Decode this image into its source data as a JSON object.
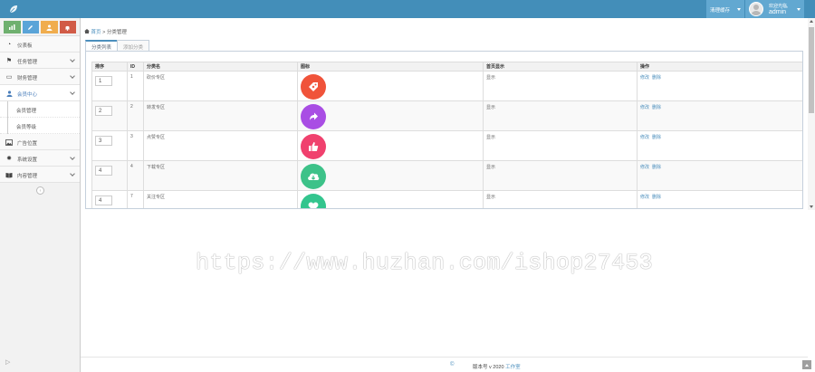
{
  "topbar": {
    "clear_cache_label": "清理缓存",
    "welcome": "欢迎光临,",
    "username": "admin"
  },
  "sidebar": {
    "items": [
      {
        "label": "仪表板",
        "icon": "dashboard-icon"
      },
      {
        "label": "任务管理",
        "icon": "flag-icon"
      },
      {
        "label": "财务管理",
        "icon": "wallet-icon"
      },
      {
        "label": "会员中心",
        "icon": "user-icon",
        "open": true
      },
      {
        "label": "广告位置",
        "icon": "picture-icon"
      },
      {
        "label": "系统设置",
        "icon": "gear-icon"
      },
      {
        "label": "内容管理",
        "icon": "book-icon"
      }
    ],
    "subitems": [
      "会员管理",
      "会员等级"
    ]
  },
  "breadcrumb": {
    "home": "首页",
    "separator": ">",
    "current": "分类管理"
  },
  "tabs": [
    "分类列表",
    "添加分类"
  ],
  "table": {
    "headers": [
      "排序",
      "ID",
      "分类名",
      "图标",
      "首页显示",
      "操作"
    ],
    "rows": [
      {
        "sort": "1",
        "id": "1",
        "name": "砍价专区",
        "icon_color": "#f0533a",
        "icon": "price-tag-icon",
        "show": "显示",
        "edit": "修改",
        "delete": "删除"
      },
      {
        "sort": "2",
        "id": "2",
        "name": "转发专区",
        "icon_color": "#a94ee4",
        "icon": "share-arrow-icon",
        "show": "显示",
        "edit": "修改",
        "delete": "删除"
      },
      {
        "sort": "3",
        "id": "3",
        "name": "点赞专区",
        "icon_color": "#f0416e",
        "icon": "thumbs-up-icon",
        "show": "显示",
        "edit": "修改",
        "delete": "删除"
      },
      {
        "sort": "4",
        "id": "4",
        "name": "下载专区",
        "icon_color": "#3dc289",
        "icon": "cloud-download-icon",
        "show": "显示",
        "edit": "修改",
        "delete": "删除"
      },
      {
        "sort": "4",
        "id": "7",
        "name": "关注专区",
        "icon_color": "#33c58e",
        "icon": "heart-icon",
        "show": "显示",
        "edit": "修改",
        "delete": "删除"
      }
    ]
  },
  "watermark": "https://www.huzhan.com/ishop27453",
  "footer": {
    "copyright": "©",
    "version": "版本号 v 2020",
    "studio": "工作室"
  },
  "colors": {
    "topbar": "#438eb9",
    "accent": "#4c8fbd",
    "shortcut_green": "#6fb06f",
    "shortcut_blue": "#5aa4d8",
    "shortcut_orange": "#f0ad4e",
    "shortcut_red": "#d15b47"
  }
}
